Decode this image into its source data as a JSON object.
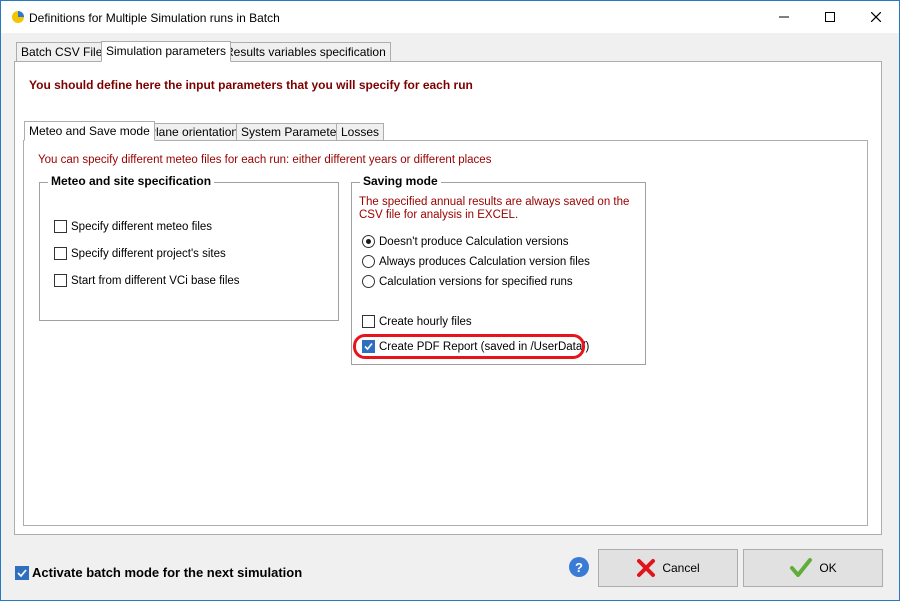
{
  "window": {
    "title": "Definitions for Multiple Simulation runs in Batch"
  },
  "tabs": [
    {
      "label": "Batch CSV Files"
    },
    {
      "label": "Simulation parameters"
    },
    {
      "label": "Results variables specification"
    }
  ],
  "main": {
    "heading": "You should define here the input parameters that you will specify for each run"
  },
  "subtabs": [
    {
      "label": "Meteo and Save mode"
    },
    {
      "label": "Plane orientation"
    },
    {
      "label": "System Parameter"
    },
    {
      "label": "Losses"
    }
  ],
  "meteo_tab": {
    "note": "You can specify different meteo files for each run: either different years or different places",
    "site_group": {
      "title": "Meteo and site specification",
      "options": [
        {
          "label": "Specify different meteo files",
          "checked": false
        },
        {
          "label": "Specify different project's sites",
          "checked": false
        },
        {
          "label": "Start from different VCi base files",
          "checked": false
        }
      ]
    },
    "saving_group": {
      "title": "Saving mode",
      "note": "The specified annual results are always saved on the CSV file for analysis in EXCEL.",
      "radios": [
        {
          "label": "Doesn't produce Calculation versions",
          "checked": true
        },
        {
          "label": "Always produces Calculation version files",
          "checked": false
        },
        {
          "label": "Calculation versions for specified runs",
          "checked": false
        }
      ],
      "hourly": {
        "label": "Create hourly files",
        "checked": false
      },
      "pdf": {
        "label": "Create PDF Report (saved in /UserData/)",
        "checked": true
      }
    }
  },
  "footer": {
    "batch_mode_label": "Activate batch mode for the next simulation",
    "batch_mode_checked": true,
    "help": "?",
    "cancel_label": "Cancel",
    "ok_label": "OK"
  },
  "colors": {
    "accent": "#2f6fbf",
    "highlight": "#e8141b",
    "note_text": "#9a0000"
  }
}
